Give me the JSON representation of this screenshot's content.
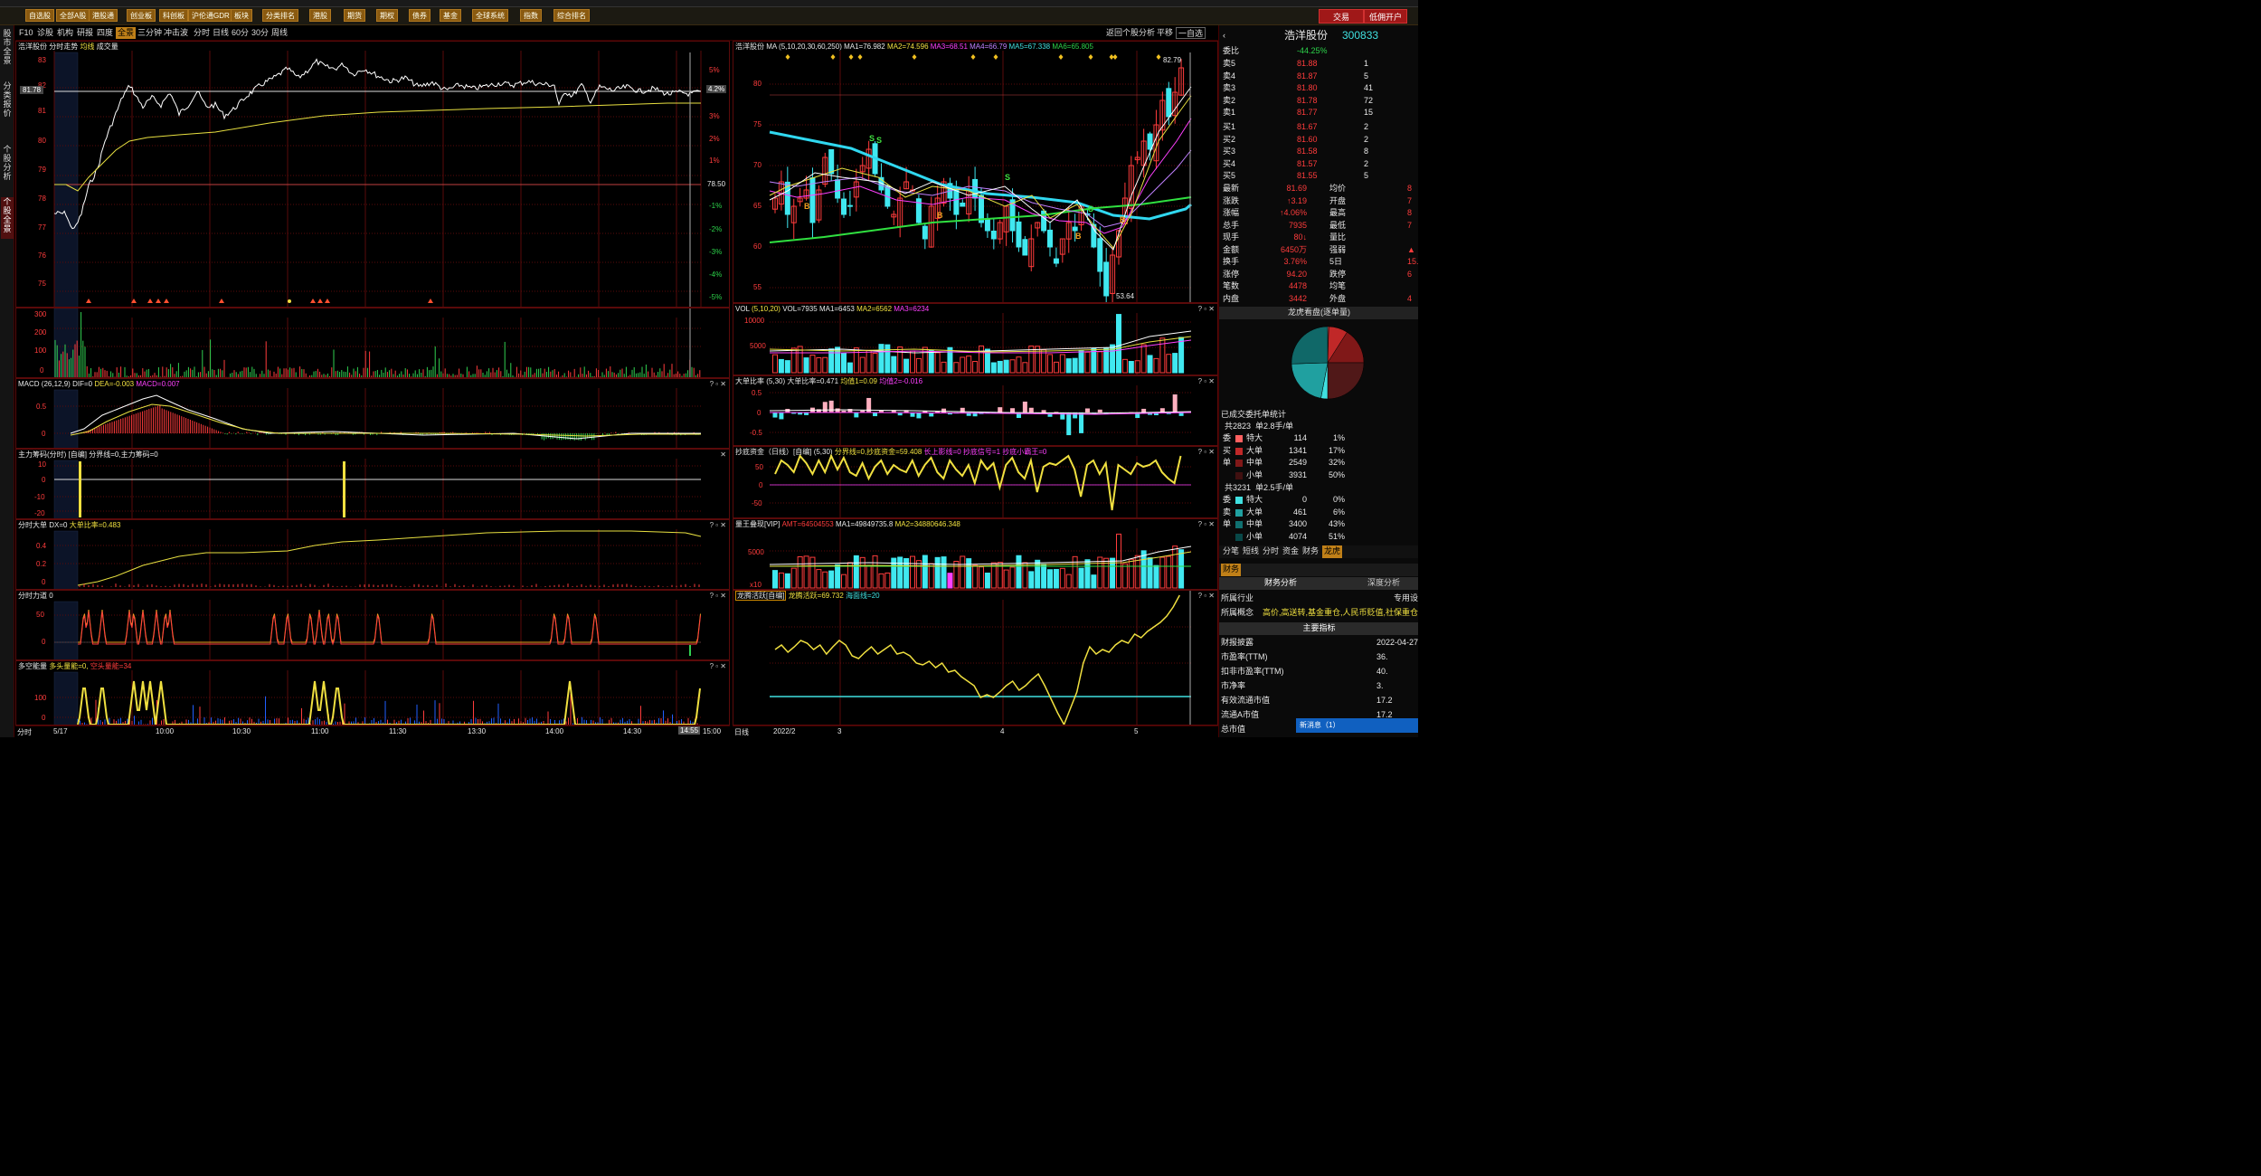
{
  "toolbar": {
    "buttons": [
      "自选股",
      "全部A股",
      "港股通",
      "创业板",
      "科创板",
      "沪伦通GDR",
      "板块",
      "分类排名",
      "港股",
      "期货",
      "期权",
      "债券",
      "基金",
      "全球系统",
      "指数",
      "综合排名"
    ],
    "trade": "交易",
    "open_account": "低佣开户"
  },
  "leftnav": {
    "tabs": [
      "股市全景",
      "分类报价",
      "个股分析",
      "个股全景"
    ]
  },
  "subbar": {
    "left": [
      "F10",
      "诊股",
      "机构",
      "研报",
      "四度",
      "全景",
      "三分钟",
      "冲击波"
    ],
    "mid": [
      "分时",
      "日线",
      "60分",
      "30分",
      "周线"
    ],
    "right": [
      "返回个股分析",
      "平移",
      "一自选"
    ]
  },
  "intraday": {
    "title": "浩洋股份",
    "subtitle": "分时走势",
    "legend1": "均线",
    "legend2": "成交量",
    "price_ticks": [
      "83",
      "82",
      "81",
      "80",
      "79",
      "78",
      "77",
      "76",
      "75"
    ],
    "current_price": "81.78",
    "pct_ticks": [
      "5%",
      "4%",
      "3%",
      "2%",
      "1%",
      "78.50",
      "-1%",
      "-2%",
      "-3%",
      "-4%",
      "-5%"
    ],
    "pct_current": "4.2%"
  },
  "vol_panel": {
    "ticks": [
      "300",
      "200",
      "100",
      "0"
    ]
  },
  "macd": {
    "title": "MACD",
    "params": "(26,12,9)",
    "dif": "DIF=0",
    "dea": "DEA=-0.003",
    "macd": "MACD=0.007",
    "ticks": [
      "0.5",
      "0",
      "-0.5"
    ]
  },
  "zhuli": {
    "title": "主力筹码(分时)",
    "tag": "[自编]",
    "text": "分界线=0,主力筹码=0",
    "ticks": [
      "10",
      "0",
      "-10",
      "-20"
    ]
  },
  "dadan": {
    "title": "分时大单",
    "text": "DX=0",
    "text2": "大单比率=0.483",
    "ticks": [
      "0.4",
      "0.2",
      "0"
    ]
  },
  "lidao": {
    "title": "分时力道",
    "text": "0",
    "ticks": [
      "50",
      "0",
      "-50"
    ]
  },
  "duokong": {
    "title": "多空能量",
    "text": "多头量能=0,",
    "text2": "空头量能=34",
    "ticks": [
      "100",
      "50",
      "0"
    ]
  },
  "intraday_axis": {
    "label": "分时",
    "times": [
      "5/17",
      "10:00",
      "10:30",
      "11:00",
      "11:30",
      "13:30",
      "14:00",
      "14:30",
      "14:55",
      "15:00"
    ]
  },
  "kline": {
    "title": "浩洋股份",
    "ma_label": "MA",
    "ma_params": "(5,10,20,30,60,250)",
    "ma1": "MA1=76.982",
    "ma2": "MA2=74.596",
    "ma3": "MA3=68.51",
    "ma4": "MA4=66.79",
    "ma5": "MA5=67.338",
    "ma6": "MA6=65.805",
    "ticks": [
      "80",
      "75",
      "70",
      "65",
      "60",
      "55"
    ],
    "high_label": "82.79",
    "low_label": "53.64"
  },
  "kvol": {
    "title": "VOL",
    "params": "(5,10,20)",
    "text": "VOL=7935",
    "ma1": "MA1=6453",
    "ma2": "MA2=6562",
    "ma3": "MA3=6234",
    "ticks": [
      "10000",
      "5000",
      "0"
    ]
  },
  "kdadan": {
    "title": "大单比率",
    "params": "(5,30)",
    "text": "大单比率=0.471",
    "ma1": "均值1=0.09",
    "ma2": "均值2=-0.016",
    "ticks": [
      "0.5",
      "0",
      "-0.5"
    ]
  },
  "chaodi": {
    "title": "抄底资金（日线）[自编]",
    "params": "(5,30)",
    "text": "分界线=0,抄底资金=59.408",
    "t2": "长上影线=0",
    "t3": "抄底信号=1",
    "t4": "抄底小霸王=0",
    "ticks": [
      "50",
      "0",
      "-50"
    ]
  },
  "liangwang": {
    "title": "量王叠现[VIP]",
    "amt": "AMT=64504553",
    "ma1": "MA1=49849735.8",
    "ma2": "MA2=34880646.348",
    "ticks": [
      "5000",
      "0"
    ],
    "unit": "x10"
  },
  "longteng": {
    "title": "龙腾活跃[自编]",
    "text": "龙腾活跃=69.732",
    "text2": "海面线=20"
  },
  "kline_axis": {
    "label": "日线",
    "dates": [
      "2022/2",
      "3",
      "4",
      "5"
    ]
  },
  "quote": {
    "name": "浩洋股份",
    "code": "300833",
    "webi_label": "委比",
    "webi": "-44.25%",
    "asks": [
      {
        "label": "卖5",
        "price": "81.88",
        "vol": "1"
      },
      {
        "label": "卖4",
        "price": "81.87",
        "vol": "5"
      },
      {
        "label": "卖3",
        "price": "81.80",
        "vol": "41"
      },
      {
        "label": "卖2",
        "price": "81.78",
        "vol": "72"
      },
      {
        "label": "卖1",
        "price": "81.77",
        "vol": "15"
      }
    ],
    "bids": [
      {
        "label": "买1",
        "price": "81.67",
        "vol": "2"
      },
      {
        "label": "买2",
        "price": "81.60",
        "vol": "2"
      },
      {
        "label": "买3",
        "price": "81.58",
        "vol": "8"
      },
      {
        "label": "买4",
        "price": "81.57",
        "vol": "2"
      },
      {
        "label": "买5",
        "price": "81.55",
        "vol": "5"
      }
    ],
    "stats": [
      {
        "l": "最新",
        "v": "81.69",
        "l2": "均价",
        "v2": "8"
      },
      {
        "l": "涨跌",
        "v": "↑3.19",
        "l2": "开盘",
        "v2": "7"
      },
      {
        "l": "涨幅",
        "v": "↑4.06%",
        "l2": "最高",
        "v2": "8"
      },
      {
        "l": "总手",
        "v": "7935",
        "l2": "最低",
        "v2": "7"
      },
      {
        "l": "现手",
        "v": "80↓",
        "l2": "量比",
        "v2": ""
      },
      {
        "l": "金额",
        "v": "6450万",
        "l2": "强弱",
        "v2": "▲"
      },
      {
        "l": "换手",
        "v": "3.76%",
        "l2": "5日",
        "v2": "15."
      },
      {
        "l": "涨停",
        "v": "94.20",
        "l2": "跌停",
        "v2": "6"
      },
      {
        "l": "笔数",
        "v": "4478",
        "l2": "均笔",
        "v2": ""
      },
      {
        "l": "内盘",
        "v": "3442",
        "l2": "外盘",
        "v2": "4"
      }
    ],
    "pie_title": "龙虎看盘(逐单量)",
    "stat_title": "已成交委托单统计",
    "buy_total": "共2823",
    "buy_avg": "单2.8手/单",
    "buy_rows": [
      {
        "k": "特大",
        "n": "114",
        "p": "1%"
      },
      {
        "k": "大单",
        "n": "1341",
        "p": "17%"
      },
      {
        "k": "中单",
        "n": "2549",
        "p": "32%"
      },
      {
        "k": "小单",
        "n": "3931",
        "p": "50%"
      }
    ],
    "sell_total": "共3231",
    "sell_avg": "单2.5手/单",
    "sell_rows": [
      {
        "k": "特大",
        "n": "0",
        "p": "0%"
      },
      {
        "k": "大单",
        "n": "461",
        "p": "6%"
      },
      {
        "k": "中单",
        "n": "3400",
        "p": "43%"
      },
      {
        "k": "小单",
        "n": "4074",
        "p": "51%"
      }
    ],
    "side_labels": [
      "委",
      "买",
      "单"
    ],
    "side_labels2": [
      "委",
      "卖",
      "单"
    ],
    "tabs": [
      "分笔",
      "短线",
      "分时",
      "资金",
      "财务",
      "龙虎"
    ],
    "fin_tab": "财务",
    "fin_sub": [
      "财务分析",
      "深度分析"
    ],
    "industry_l": "所属行业",
    "industry_v": "专用设",
    "concept_l": "所属概念",
    "concept_v": "高价,高送转,基金重仓,人民币贬值,社保重仓,中",
    "main_idx": "主要指标",
    "fin_rows": [
      {
        "l": "财报披露",
        "v": "2022-04-27"
      },
      {
        "l": "市盈率(TTM)",
        "v": "36."
      },
      {
        "l": "扣非市盈率(TTM)",
        "v": "40."
      },
      {
        "l": "市净率",
        "v": "3."
      },
      {
        "l": "有效流通市值",
        "v": "17.2"
      },
      {
        "l": "流通A市值",
        "v": "17.2"
      },
      {
        "l": "总市值",
        "v": ""
      }
    ],
    "news": "新消息（1）"
  },
  "colors": {
    "up": "#ff3c3c",
    "down": "#40e8f0",
    "ma_white": "#ffffff",
    "ma_yellow": "#e8e040",
    "ma_cyan": "#30d8f0",
    "ma_green": "#30e040",
    "border": "#5a0a0a"
  }
}
